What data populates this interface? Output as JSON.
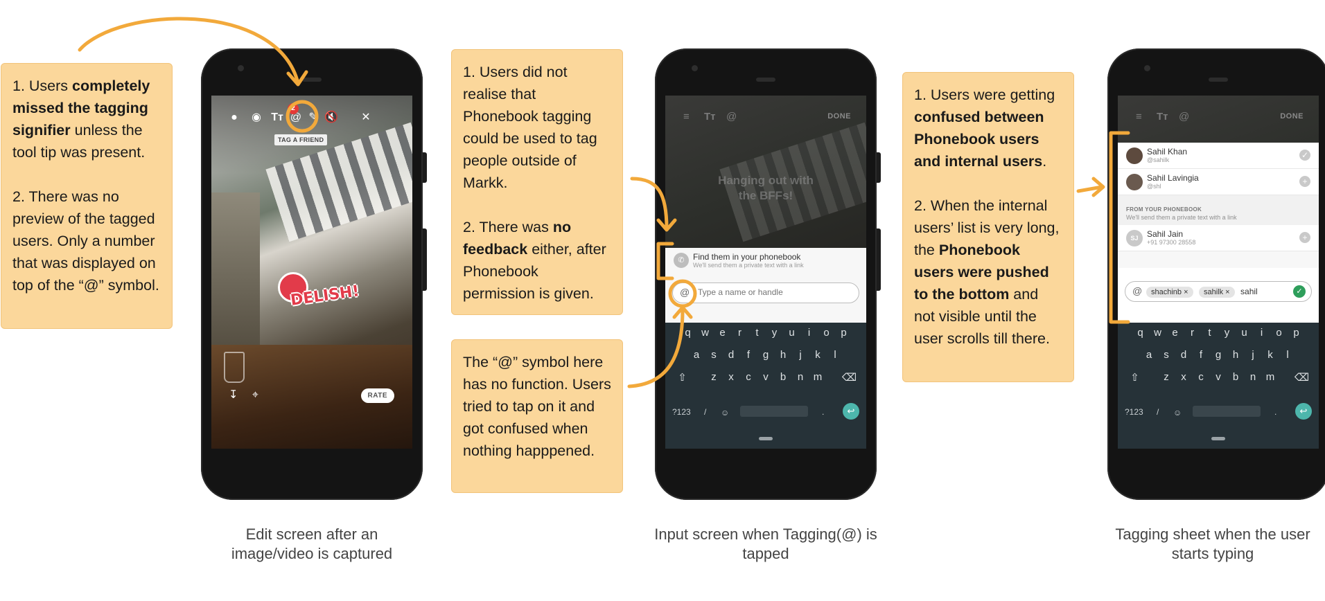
{
  "notes": {
    "note1": {
      "p1_pre": "1. Users ",
      "p1_bold": "completely missed the tagging signifier",
      "p1_post": " unless the tool tip was present.",
      "p2": "2. There was no preview of the tagged users. Only a number that was displayed on top of the “@” symbol."
    },
    "note2": {
      "p1": "1. Users did not realise that Phonebook tagging could be used to tag people outside of Markk.",
      "p2_pre": "2. There was ",
      "p2_bold": "no feedback",
      "p2_post": " either, after Phonebook permission is given."
    },
    "note3": {
      "p1": "The “@” symbol here has no function. Users tried to tap on it and got confused when nothing happpened."
    },
    "note4": {
      "p1_pre": "1. Users were getting ",
      "p1_bold": "confused between Phonebook users and internal users",
      "p1_post": ".",
      "p2_pre": "2. When the internal users’ list is very long, the ",
      "p2_bold": "Phonebook users were pushed to the bottom",
      "p2_post": " and not visible until the user scrolls till there."
    }
  },
  "captions": {
    "c1": "Edit screen after an image/video is captured",
    "c2": "Input screen when Tagging(@) is tapped",
    "c3": "Tagging sheet when the user starts typing"
  },
  "phone1": {
    "badge_count": "2",
    "tooltip": "TAG A FRIEND",
    "sticker_text": "DELISH!",
    "rate_label": "RATE",
    "icons": [
      "location-icon",
      "sticker-icon",
      "text-icon",
      "at-icon",
      "brush-icon",
      "mute-icon",
      "close-icon"
    ]
  },
  "phone2": {
    "done_label": "DONE",
    "overlay_text": "Hanging out with the BFFs!",
    "phonebook_title": "Find them in your phonebook",
    "phonebook_sub": "We'll send them a private text with a link",
    "input_placeholder": "Type a name or handle"
  },
  "phone3": {
    "done_label": "DONE",
    "users": [
      {
        "name": "Sahil Khan",
        "handle": "@sahilk",
        "action": "✓"
      },
      {
        "name": "Sahil Lavingia",
        "handle": "@shl",
        "action": "+"
      }
    ],
    "phonebook_head": "FROM YOUR PHONEBOOK",
    "phonebook_sub": "We'll send them a private text with a link",
    "contact": {
      "initials": "SJ",
      "name": "Sahil Jain",
      "number": "+91 97300 28558",
      "action": "+"
    },
    "chips": [
      "shachinb",
      "sahilk"
    ],
    "typed": "sahil"
  },
  "keyboard": {
    "row1": [
      "q",
      "w",
      "e",
      "r",
      "t",
      "y",
      "u",
      "i",
      "o",
      "p"
    ],
    "row2": [
      "a",
      "s",
      "d",
      "f",
      "g",
      "h",
      "j",
      "k",
      "l"
    ],
    "row3": [
      "z",
      "x",
      "c",
      "v",
      "b",
      "n",
      "m"
    ],
    "num_key": "?123",
    "slash_key": "/",
    "dot_key": "."
  },
  "colors": {
    "note_bg": "#fbd79b",
    "arrow": "#f2a93b",
    "keyboard": "#263238",
    "enter": "#4db6ac"
  }
}
